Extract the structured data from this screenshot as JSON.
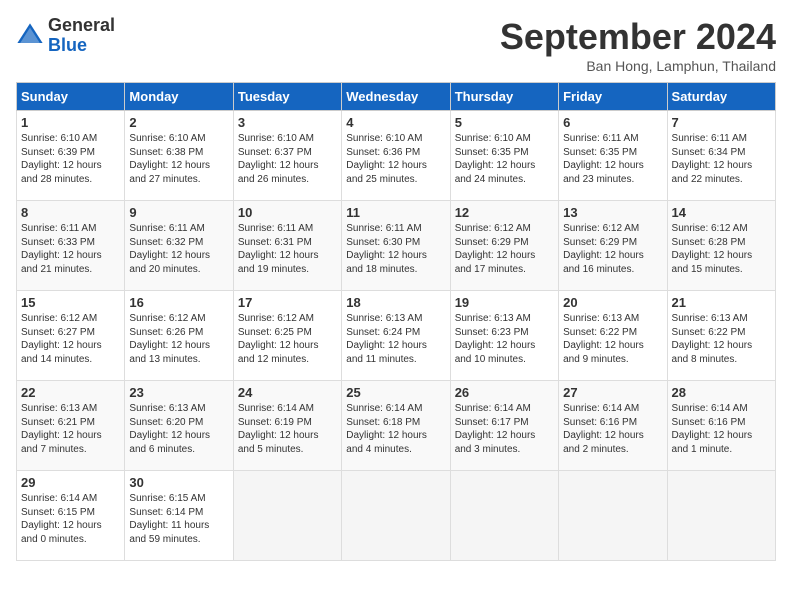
{
  "header": {
    "logo_general": "General",
    "logo_blue": "Blue",
    "month": "September 2024",
    "location": "Ban Hong, Lamphun, Thailand"
  },
  "days_of_week": [
    "Sunday",
    "Monday",
    "Tuesday",
    "Wednesday",
    "Thursday",
    "Friday",
    "Saturday"
  ],
  "weeks": [
    [
      {
        "day": "1",
        "lines": [
          "Sunrise: 6:10 AM",
          "Sunset: 6:39 PM",
          "Daylight: 12 hours",
          "and 28 minutes."
        ]
      },
      {
        "day": "2",
        "lines": [
          "Sunrise: 6:10 AM",
          "Sunset: 6:38 PM",
          "Daylight: 12 hours",
          "and 27 minutes."
        ]
      },
      {
        "day": "3",
        "lines": [
          "Sunrise: 6:10 AM",
          "Sunset: 6:37 PM",
          "Daylight: 12 hours",
          "and 26 minutes."
        ]
      },
      {
        "day": "4",
        "lines": [
          "Sunrise: 6:10 AM",
          "Sunset: 6:36 PM",
          "Daylight: 12 hours",
          "and 25 minutes."
        ]
      },
      {
        "day": "5",
        "lines": [
          "Sunrise: 6:10 AM",
          "Sunset: 6:35 PM",
          "Daylight: 12 hours",
          "and 24 minutes."
        ]
      },
      {
        "day": "6",
        "lines": [
          "Sunrise: 6:11 AM",
          "Sunset: 6:35 PM",
          "Daylight: 12 hours",
          "and 23 minutes."
        ]
      },
      {
        "day": "7",
        "lines": [
          "Sunrise: 6:11 AM",
          "Sunset: 6:34 PM",
          "Daylight: 12 hours",
          "and 22 minutes."
        ]
      }
    ],
    [
      {
        "day": "8",
        "lines": [
          "Sunrise: 6:11 AM",
          "Sunset: 6:33 PM",
          "Daylight: 12 hours",
          "and 21 minutes."
        ]
      },
      {
        "day": "9",
        "lines": [
          "Sunrise: 6:11 AM",
          "Sunset: 6:32 PM",
          "Daylight: 12 hours",
          "and 20 minutes."
        ]
      },
      {
        "day": "10",
        "lines": [
          "Sunrise: 6:11 AM",
          "Sunset: 6:31 PM",
          "Daylight: 12 hours",
          "and 19 minutes."
        ]
      },
      {
        "day": "11",
        "lines": [
          "Sunrise: 6:11 AM",
          "Sunset: 6:30 PM",
          "Daylight: 12 hours",
          "and 18 minutes."
        ]
      },
      {
        "day": "12",
        "lines": [
          "Sunrise: 6:12 AM",
          "Sunset: 6:29 PM",
          "Daylight: 12 hours",
          "and 17 minutes."
        ]
      },
      {
        "day": "13",
        "lines": [
          "Sunrise: 6:12 AM",
          "Sunset: 6:29 PM",
          "Daylight: 12 hours",
          "and 16 minutes."
        ]
      },
      {
        "day": "14",
        "lines": [
          "Sunrise: 6:12 AM",
          "Sunset: 6:28 PM",
          "Daylight: 12 hours",
          "and 15 minutes."
        ]
      }
    ],
    [
      {
        "day": "15",
        "lines": [
          "Sunrise: 6:12 AM",
          "Sunset: 6:27 PM",
          "Daylight: 12 hours",
          "and 14 minutes."
        ]
      },
      {
        "day": "16",
        "lines": [
          "Sunrise: 6:12 AM",
          "Sunset: 6:26 PM",
          "Daylight: 12 hours",
          "and 13 minutes."
        ]
      },
      {
        "day": "17",
        "lines": [
          "Sunrise: 6:12 AM",
          "Sunset: 6:25 PM",
          "Daylight: 12 hours",
          "and 12 minutes."
        ]
      },
      {
        "day": "18",
        "lines": [
          "Sunrise: 6:13 AM",
          "Sunset: 6:24 PM",
          "Daylight: 12 hours",
          "and 11 minutes."
        ]
      },
      {
        "day": "19",
        "lines": [
          "Sunrise: 6:13 AM",
          "Sunset: 6:23 PM",
          "Daylight: 12 hours",
          "and 10 minutes."
        ]
      },
      {
        "day": "20",
        "lines": [
          "Sunrise: 6:13 AM",
          "Sunset: 6:22 PM",
          "Daylight: 12 hours",
          "and 9 minutes."
        ]
      },
      {
        "day": "21",
        "lines": [
          "Sunrise: 6:13 AM",
          "Sunset: 6:22 PM",
          "Daylight: 12 hours",
          "and 8 minutes."
        ]
      }
    ],
    [
      {
        "day": "22",
        "lines": [
          "Sunrise: 6:13 AM",
          "Sunset: 6:21 PM",
          "Daylight: 12 hours",
          "and 7 minutes."
        ]
      },
      {
        "day": "23",
        "lines": [
          "Sunrise: 6:13 AM",
          "Sunset: 6:20 PM",
          "Daylight: 12 hours",
          "and 6 minutes."
        ]
      },
      {
        "day": "24",
        "lines": [
          "Sunrise: 6:14 AM",
          "Sunset: 6:19 PM",
          "Daylight: 12 hours",
          "and 5 minutes."
        ]
      },
      {
        "day": "25",
        "lines": [
          "Sunrise: 6:14 AM",
          "Sunset: 6:18 PM",
          "Daylight: 12 hours",
          "and 4 minutes."
        ]
      },
      {
        "day": "26",
        "lines": [
          "Sunrise: 6:14 AM",
          "Sunset: 6:17 PM",
          "Daylight: 12 hours",
          "and 3 minutes."
        ]
      },
      {
        "day": "27",
        "lines": [
          "Sunrise: 6:14 AM",
          "Sunset: 6:16 PM",
          "Daylight: 12 hours",
          "and 2 minutes."
        ]
      },
      {
        "day": "28",
        "lines": [
          "Sunrise: 6:14 AM",
          "Sunset: 6:16 PM",
          "Daylight: 12 hours",
          "and 1 minute."
        ]
      }
    ],
    [
      {
        "day": "29",
        "lines": [
          "Sunrise: 6:14 AM",
          "Sunset: 6:15 PM",
          "Daylight: 12 hours",
          "and 0 minutes."
        ]
      },
      {
        "day": "30",
        "lines": [
          "Sunrise: 6:15 AM",
          "Sunset: 6:14 PM",
          "Daylight: 11 hours",
          "and 59 minutes."
        ]
      },
      {
        "day": "",
        "lines": []
      },
      {
        "day": "",
        "lines": []
      },
      {
        "day": "",
        "lines": []
      },
      {
        "day": "",
        "lines": []
      },
      {
        "day": "",
        "lines": []
      }
    ]
  ]
}
